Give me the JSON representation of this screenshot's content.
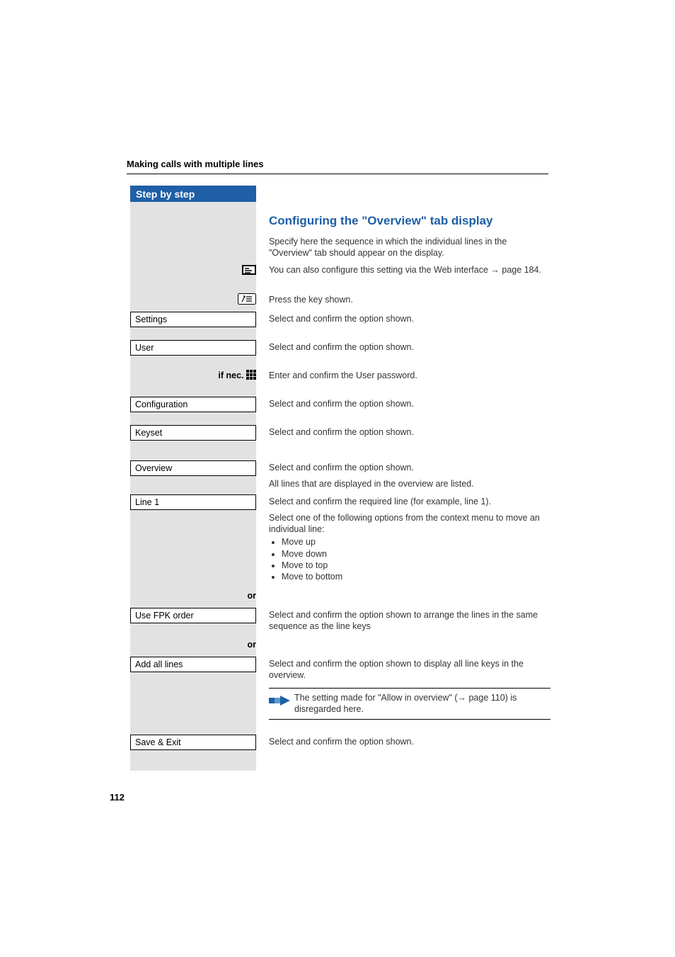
{
  "page": {
    "header": "Making calls with multiple lines",
    "sidebar_title": "Step by step",
    "page_number": "112"
  },
  "heading": "Configuring the \"Overview\" tab display",
  "intro": "Specify here the sequence in which the individual lines in the \"Overview\" tab should appear on the display.",
  "web_note": "You can also configure this setting via the Web interface ",
  "web_note_link": "→ page 184.",
  "press_key": "Press the key shown.",
  "menu": {
    "settings": "Settings",
    "user": "User",
    "configuration": "Configuration",
    "keyset": "Keyset",
    "overview": "Overview",
    "line1": "Line 1",
    "use_fpk": "Use FPK order",
    "add_all": "Add all lines",
    "save_exit": "Save & Exit"
  },
  "labels": {
    "if_nec": "if nec.",
    "or": "or"
  },
  "desc": {
    "select_confirm": "Select and confirm the option shown.",
    "enter_confirm_pw": "Enter and confirm the User password.",
    "all_lines_listed": "All lines that are displayed in the overview are listed.",
    "select_line": "Select and confirm the required line (for example, line 1).",
    "select_context": "Select one of the following options from the context menu to move an individual line:",
    "moves": [
      "Move up",
      "Move down",
      "Move to top",
      "Move to bottom"
    ],
    "fpk_desc": "Select and confirm the option shown to arrange the lines in the same sequence as the line keys",
    "add_all_desc": "Select and confirm the option shown to display all line keys in the overview.",
    "note_allow1": "The setting made for \"Allow in overview\" (",
    "note_allow_link": "→ page 110",
    "note_allow2": ") is disregarded here."
  }
}
